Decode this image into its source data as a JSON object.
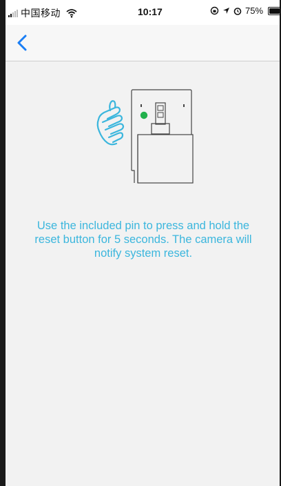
{
  "status_bar": {
    "carrier": "中国移动",
    "time": "10:17",
    "battery_percent": "75%",
    "battery_level": 0.75,
    "icons": [
      "signal-icon",
      "wifi-icon",
      "lock-rotation-icon",
      "location-icon",
      "alarm-icon",
      "battery-icon"
    ]
  },
  "nav": {
    "back_icon": "chevron-left-icon"
  },
  "main": {
    "illustration_icon": "reset-button-illustration",
    "instruction": "Use the included pin to press and hold the reset button for 5 seconds. The camera will notify system reset."
  },
  "colors": {
    "accent": "#3bb6dd",
    "ios_blue": "#1a7ef5",
    "led_green": "#22b14c",
    "background": "#f2f2f2"
  }
}
